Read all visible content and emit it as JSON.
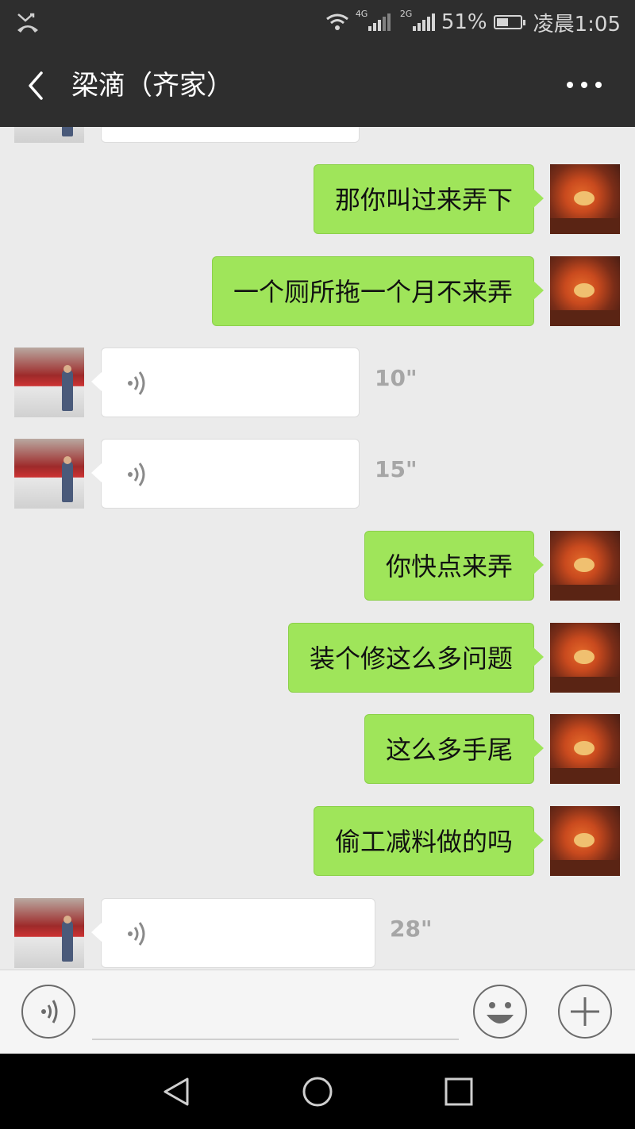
{
  "status_bar": {
    "network_4g": "4G",
    "network_2g": "2G",
    "battery": "51%",
    "battery_level": 0.51,
    "time": "凌晨1:05"
  },
  "header": {
    "title": "梁滴（齐家）"
  },
  "messages": [
    {
      "sender": "me",
      "text": "那你叫过来弄下"
    },
    {
      "sender": "me",
      "text": "一个厕所拖一个月不来弄"
    },
    {
      "sender": "other",
      "type": "voice",
      "duration": "10\""
    },
    {
      "sender": "other",
      "type": "voice",
      "duration": "15\""
    },
    {
      "sender": "me",
      "text": "你快点来弄"
    },
    {
      "sender": "me",
      "text": "装个修这么多问题"
    },
    {
      "sender": "me",
      "text": "这么多手尾"
    },
    {
      "sender": "me",
      "text": "偷工减料做的吗"
    },
    {
      "sender": "other",
      "type": "voice",
      "duration": "28\""
    }
  ],
  "input_bar": {
    "voice_toggle_icon": "voice-toggle-icon",
    "emoji_icon": "emoji-icon",
    "plus_icon": "plus-icon"
  },
  "colors": {
    "header_bg": "#2e2e2e",
    "chat_bg": "#ebebeb",
    "my_bubble": "#9fe55a",
    "other_bubble": "#ffffff"
  }
}
